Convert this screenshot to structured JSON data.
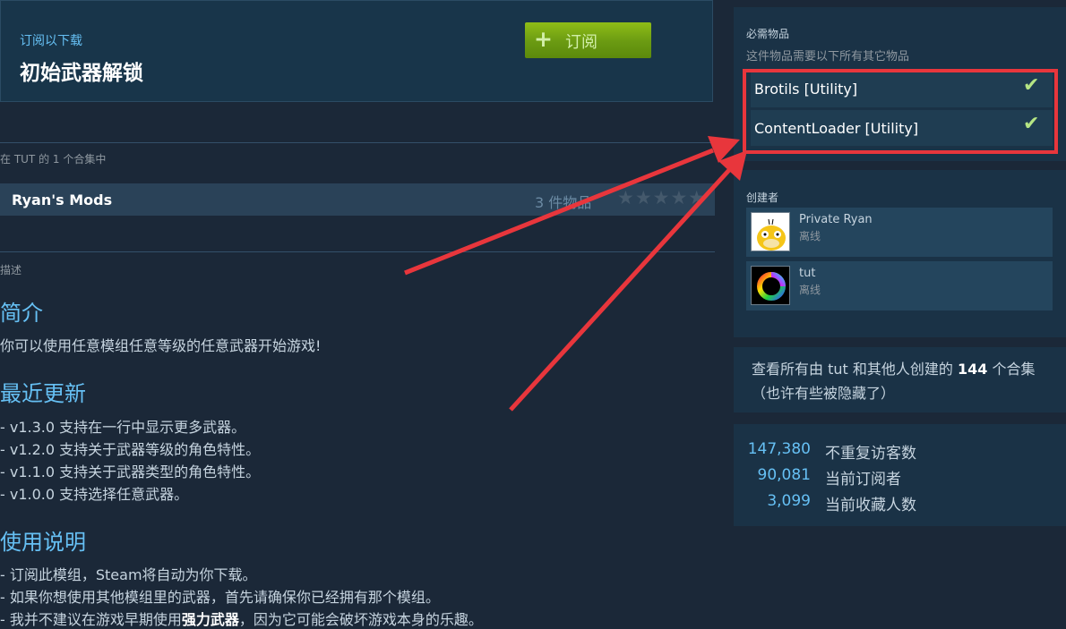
{
  "subscribe": {
    "caption": "订阅以下载",
    "title": "初始武器解锁",
    "button_label": "订阅",
    "button_icon": "plus-icon"
  },
  "collection": {
    "caption": "在 TUT 的 1 个合集中",
    "name": "Ryan's Mods",
    "count": "3 件物品",
    "stars": "★★★★★"
  },
  "description": {
    "label": "描述",
    "sections": [
      {
        "heading": "简介",
        "lines": [
          "你可以使用任意模组任意等级的任意武器开始游戏!"
        ]
      },
      {
        "heading": "最近更新",
        "lines": [
          "- v1.3.0 支持在一行中显示更多武器。",
          "- v1.2.0 支持关于武器等级的角色特性。",
          "- v1.1.0 支持关于武器类型的角色特性。",
          "- v1.0.0 支持选择任意武器。"
        ]
      },
      {
        "heading": "使用说明",
        "lines": [
          "- 订阅此模组，Steam将自动为你下载。",
          "- 如果你想使用其他模组里的武器，首先请确保你已经拥有那个模组。"
        ]
      }
    ],
    "last_line": {
      "pre": "- 我并不建议在游戏早期使用",
      "bold": "强力武器",
      "post": "，因为它可能会破坏游戏本身的乐趣。"
    }
  },
  "required": {
    "title": "必需物品",
    "subtitle": "这件物品需要以下所有其它物品",
    "items": [
      {
        "name": "Brotils [Utility]",
        "check": "✔"
      },
      {
        "name": "ContentLoader [Utility]",
        "check": "✔"
      }
    ]
  },
  "creators": {
    "title": "创建者",
    "list": [
      {
        "name": "Private Ryan",
        "status": "离线",
        "avatar": "psyduck-avatar"
      },
      {
        "name": "tut",
        "status": "离线",
        "avatar": "color-wheel-avatar"
      }
    ]
  },
  "more": {
    "pre": "查看所有由 tut 和其他人创建的 ",
    "count": "144",
    "post": " 个合集（也许有些被隐藏了）"
  },
  "stats": [
    {
      "value": "147,380",
      "label": "不重复访客数"
    },
    {
      "value": "90,081",
      "label": "当前订阅者"
    },
    {
      "value": "3,099",
      "label": "当前收藏人数"
    }
  ],
  "colors": {
    "background": "#1b2838",
    "accent": "#66c0f4",
    "subscribe_green": "#6a9a12",
    "annotation_red": "#e8363c"
  }
}
